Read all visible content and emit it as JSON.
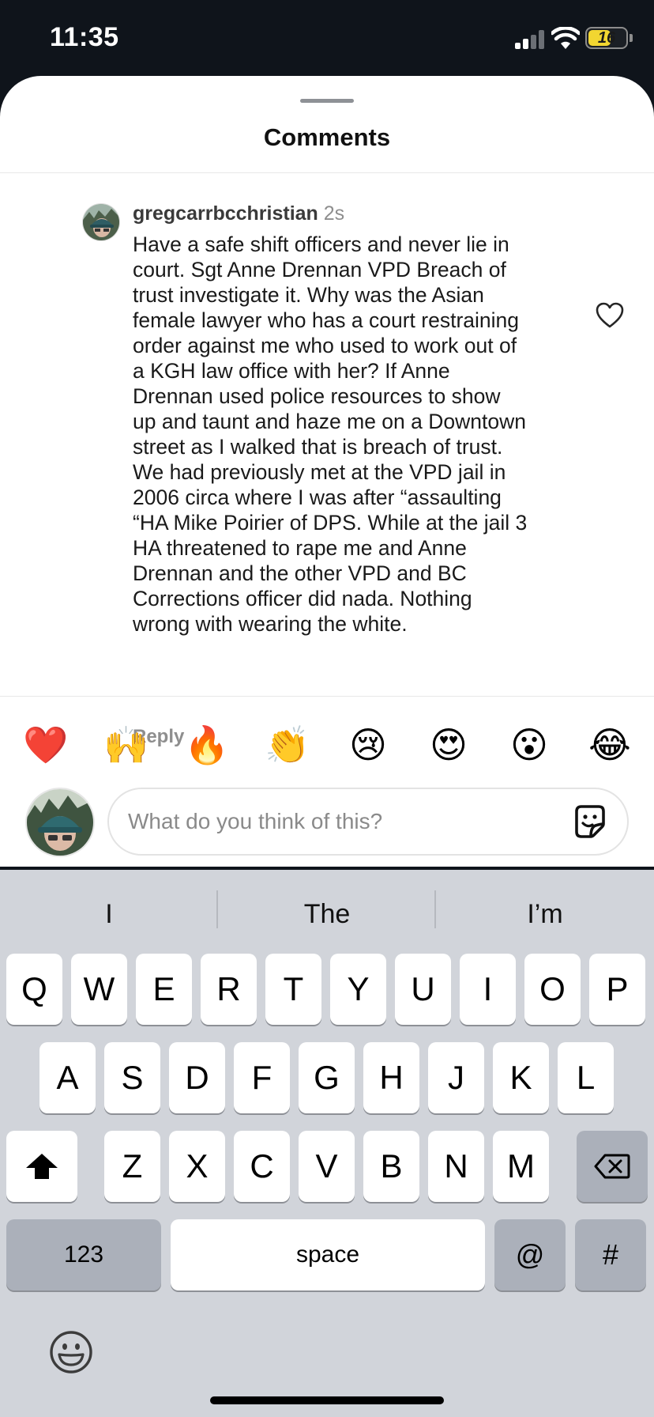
{
  "status_bar": {
    "time": "11:35",
    "battery": "16"
  },
  "sheet": {
    "title": "Comments"
  },
  "comment": {
    "username": "gregcarrbcchristian",
    "time": "2s",
    "lines": [
      "Have a safe shift officers and never lie in",
      "court. Sgt Anne Drennan VPD Breach of",
      "trust investigate it. Why was the Asian",
      "female lawyer who has a court restraining",
      "order against me who used to work out of",
      "a KGH law office with her? If Anne",
      "Drennan used police resources to show",
      "up and taunt and haze me on a Downtown",
      "street as I walked that is breach of trust.",
      "We had previously met at the VPD jail in",
      "2006 circa where I was after “assaulting",
      "“HA Mike Poirier of DPS. While at the jail 3",
      "HA threatened to rape me and Anne",
      "Drennan and the other VPD and BC",
      "Corrections officer did nada. Nothing",
      "wrong with wearing the white."
    ],
    "reply_label": "Reply"
  },
  "emoji_reactions": [
    "❤️",
    "🙌",
    "🔥",
    "👏",
    "😢",
    "😍",
    "😮",
    "😂"
  ],
  "input": {
    "placeholder": "What do you think of this?",
    "value": ""
  },
  "keyboard": {
    "suggestions": [
      "I",
      "The",
      "I’m"
    ],
    "row1": [
      "Q",
      "W",
      "E",
      "R",
      "T",
      "Y",
      "U",
      "I",
      "O",
      "P"
    ],
    "row2": [
      "A",
      "S",
      "D",
      "F",
      "G",
      "H",
      "J",
      "K",
      "L"
    ],
    "row3": [
      "Z",
      "X",
      "C",
      "V",
      "B",
      "N",
      "M"
    ],
    "numbers_label": "123",
    "space_label": "space",
    "at_label": "@",
    "hash_label": "#"
  }
}
